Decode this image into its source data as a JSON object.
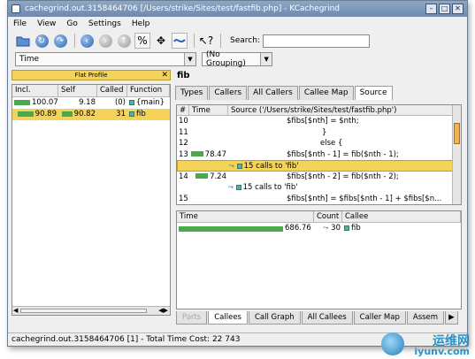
{
  "window": {
    "title": "cachegrind.out.3158464706 [/Users/strike/Sites/test/fastfib.php] - KCachegrind"
  },
  "menu": [
    "File",
    "View",
    "Go",
    "Settings",
    "Help"
  ],
  "toolbar": {
    "percent_label": "%",
    "search_label": "Search:",
    "search_value": ""
  },
  "selectors": {
    "event_type": "Time",
    "grouping": "(No Grouping)"
  },
  "flat_profile": {
    "title": "Flat Profile",
    "columns": [
      "Incl.",
      "Self",
      "Called",
      "Function"
    ],
    "rows": [
      {
        "incl": "100.07",
        "self": "9.18",
        "called": "(0)",
        "function": "{main}",
        "selected": false
      },
      {
        "incl": "90.89",
        "self": "90.82",
        "called": "31",
        "function": "fib",
        "selected": true
      }
    ]
  },
  "function_panel": {
    "name": "fib",
    "tabs": [
      "Types",
      "Callers",
      "All Callers",
      "Callee Map",
      "Source"
    ],
    "active_tab": "Source",
    "source": {
      "columns": [
        "#",
        "Time",
        "Source ('/Users/strike/Sites/test/fastfib.php')"
      ],
      "lines": [
        {
          "num": "10",
          "time": "",
          "code": "$fibs[$nth] = $nth;"
        },
        {
          "num": "11",
          "time": "",
          "code": "}"
        },
        {
          "num": "12",
          "time": "",
          "code": "else {"
        },
        {
          "num": "13",
          "time": "78.47",
          "code": "$fibs[$nth - 1] = fib($nth - 1);"
        },
        {
          "num": "",
          "time": "",
          "code": "15 calls to 'fib'",
          "call": true,
          "highlight": true
        },
        {
          "num": "14",
          "time": "7.24",
          "code": "$fibs[$nth - 2] = fib($nth - 2);"
        },
        {
          "num": "",
          "time": "",
          "code": "15 calls to 'fib'",
          "call": true
        },
        {
          "num": "15",
          "time": "",
          "code": "$fibs[$nth] = $fibs[$nth - 1] + $fibs[$n..."
        }
      ]
    },
    "callees": {
      "columns": [
        "Time",
        "Count",
        "Callee"
      ],
      "rows": [
        {
          "time": "686.76",
          "count": "30",
          "callee": "fib"
        }
      ]
    },
    "bottom_tabs": [
      "Parts",
      "Callees",
      "Call Graph",
      "All Callees",
      "Caller Map",
      "Assem"
    ],
    "active_bottom_tab": "Callees"
  },
  "status": "cachegrind.out.3158464706 [1] - Total Time Cost: 22 743",
  "watermark": {
    "line1": "运维网",
    "line2": "iyunv.com"
  }
}
